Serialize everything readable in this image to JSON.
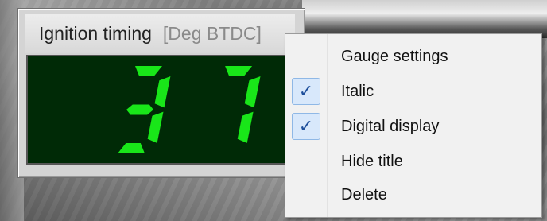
{
  "gauge": {
    "title": "Ignition timing",
    "unit": "[Deg BTDC]",
    "value": "37",
    "digit_color": "#19e619",
    "display_bg": "#002a06"
  },
  "menu": {
    "items": [
      {
        "label": "Gauge settings",
        "checked": false
      },
      {
        "label": "Italic",
        "checked": true
      },
      {
        "label": "Digital display",
        "checked": true
      },
      {
        "label": "Hide title",
        "checked": false
      },
      {
        "label": "Delete",
        "checked": false
      }
    ],
    "check_glyph": "✓"
  }
}
